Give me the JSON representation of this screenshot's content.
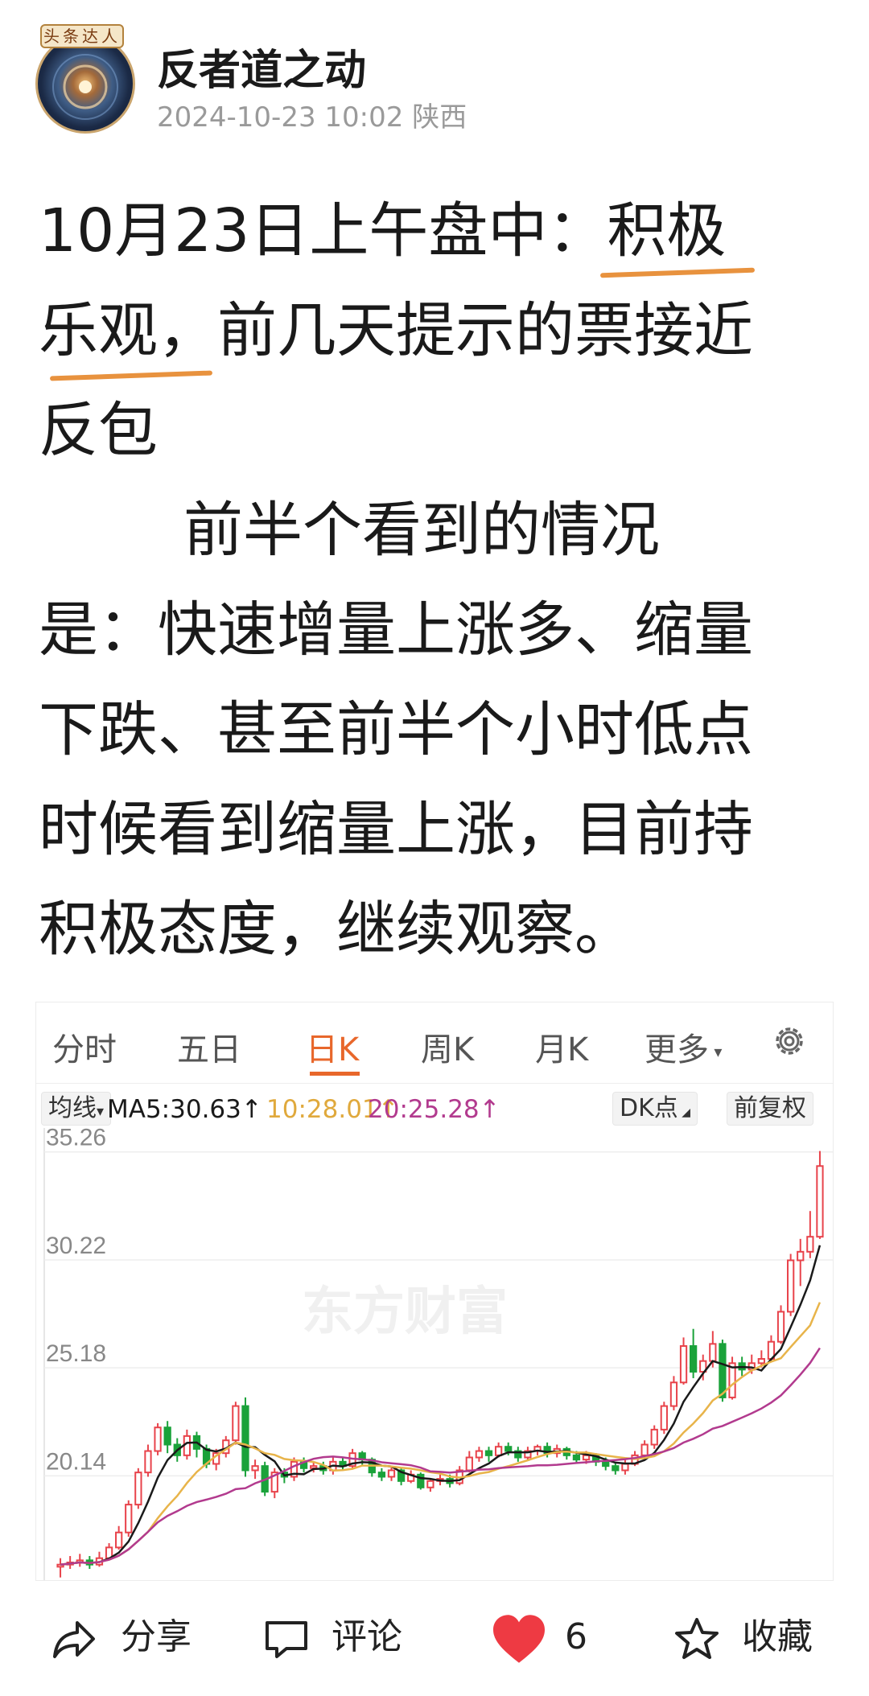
{
  "author": {
    "name": "反者道之动",
    "time": "2024-10-23 10:02",
    "location": "陕西",
    "badge": "头条达人"
  },
  "article": {
    "line1_pre": "10月23日上午盘中：",
    "highlight1": "积极",
    "highlight2": "乐观，",
    "line2_rest": "前几天提示的票接近",
    "line3": "反包",
    "para2_indent": "前半个看到的情况",
    "para2_body_1": "是：快速增量上涨多、缩量",
    "para2_body_2": "下跌、甚至前半个小时低点",
    "para2_body_3": "时候看到缩量上涨，目前持",
    "para2_body_4": "积极态度，继续观察。"
  },
  "stock": {
    "tabs": [
      "分时",
      "五日",
      "日K",
      "周K",
      "月K",
      "更多"
    ],
    "active_tab": "日K",
    "ma_selector": "均线",
    "ma5": "MA5:30.63",
    "ma10": "10:28.01",
    "ma20": "20:25.28",
    "dk_label": "DK点",
    "fuquan_label": "前复权",
    "watermark": "东方财富",
    "colors": {
      "up": "#e8434b",
      "down": "#1aa23a",
      "ma5": "#1a1a1a",
      "ma10": "#e8b44a",
      "ma20": "#b23a8e"
    },
    "controls": [
      "«",
      "−",
      "+",
      "‹",
      "›",
      "⤢"
    ]
  },
  "chart_data": {
    "type": "candlestick",
    "y_ticks": [
      "35.26",
      "30.22",
      "25.18",
      "20.14"
    ],
    "ylim": [
      15.5,
      36.0
    ],
    "candles": [
      [
        15.9,
        16.0,
        15.4,
        16.3
      ],
      [
        16.0,
        16.1,
        15.8,
        16.4
      ],
      [
        16.1,
        16.2,
        15.9,
        16.5
      ],
      [
        16.2,
        16.0,
        15.8,
        16.4
      ],
      [
        16.0,
        16.3,
        15.9,
        16.6
      ],
      [
        16.3,
        16.8,
        16.2,
        17.0
      ],
      [
        16.8,
        17.5,
        16.7,
        17.8
      ],
      [
        17.5,
        18.8,
        17.3,
        19.0
      ],
      [
        18.8,
        20.3,
        18.6,
        20.5
      ],
      [
        20.3,
        21.3,
        20.1,
        21.6
      ],
      [
        21.3,
        22.4,
        21.1,
        22.6
      ],
      [
        22.4,
        21.6,
        21.2,
        22.7
      ],
      [
        21.6,
        21.1,
        20.8,
        21.9
      ],
      [
        21.1,
        22.0,
        20.9,
        22.3
      ],
      [
        22.0,
        21.4,
        21.0,
        22.2
      ],
      [
        21.4,
        20.7,
        20.5,
        21.6
      ],
      [
        20.7,
        21.2,
        20.4,
        21.4
      ],
      [
        21.2,
        21.8,
        21.0,
        22.0
      ],
      [
        21.8,
        23.4,
        21.6,
        23.6
      ],
      [
        23.4,
        20.4,
        20.1,
        23.8
      ],
      [
        20.4,
        20.6,
        20.0,
        20.9
      ],
      [
        20.6,
        19.4,
        19.2,
        20.8
      ],
      [
        19.4,
        20.3,
        19.1,
        20.5
      ],
      [
        20.3,
        20.1,
        19.8,
        20.5
      ],
      [
        20.1,
        20.8,
        19.9,
        21.0
      ],
      [
        20.8,
        20.5,
        20.3,
        21.0
      ],
      [
        20.5,
        20.6,
        20.3,
        20.8
      ],
      [
        20.6,
        20.4,
        20.2,
        20.8
      ],
      [
        20.4,
        20.8,
        20.2,
        21.0
      ],
      [
        20.8,
        20.6,
        20.4,
        21.0
      ],
      [
        20.6,
        21.2,
        20.5,
        21.4
      ],
      [
        21.2,
        20.9,
        20.6,
        21.3
      ],
      [
        20.9,
        20.3,
        20.1,
        21.0
      ],
      [
        20.3,
        20.1,
        19.9,
        20.5
      ],
      [
        20.1,
        20.4,
        19.9,
        20.6
      ],
      [
        20.4,
        19.9,
        19.7,
        20.5
      ],
      [
        19.9,
        20.2,
        19.8,
        20.4
      ],
      [
        20.2,
        19.6,
        19.5,
        20.3
      ],
      [
        19.6,
        19.9,
        19.4,
        20.0
      ],
      [
        19.9,
        20.0,
        19.7,
        20.2
      ],
      [
        20.0,
        19.8,
        19.6,
        20.2
      ],
      [
        19.8,
        20.4,
        19.7,
        20.6
      ],
      [
        20.4,
        21.0,
        20.3,
        21.3
      ],
      [
        21.0,
        21.3,
        20.8,
        21.5
      ],
      [
        21.3,
        21.1,
        20.8,
        21.5
      ],
      [
        21.1,
        21.5,
        21.0,
        21.7
      ],
      [
        21.5,
        21.3,
        21.1,
        21.7
      ],
      [
        21.3,
        21.0,
        20.8,
        21.5
      ],
      [
        21.0,
        21.3,
        20.9,
        21.5
      ],
      [
        21.3,
        21.5,
        21.1,
        21.6
      ],
      [
        21.5,
        21.2,
        21.0,
        21.7
      ],
      [
        21.2,
        21.4,
        21.0,
        21.6
      ],
      [
        21.4,
        21.1,
        20.9,
        21.5
      ],
      [
        21.1,
        20.9,
        20.7,
        21.3
      ],
      [
        20.9,
        21.1,
        20.7,
        21.3
      ],
      [
        21.1,
        20.8,
        20.6,
        21.2
      ],
      [
        20.8,
        20.6,
        20.4,
        21.0
      ],
      [
        20.6,
        20.4,
        20.2,
        20.8
      ],
      [
        20.4,
        20.7,
        20.2,
        20.9
      ],
      [
        20.7,
        21.1,
        20.6,
        21.3
      ],
      [
        21.1,
        21.6,
        21.0,
        21.8
      ],
      [
        21.6,
        22.3,
        21.4,
        22.5
      ],
      [
        22.3,
        23.4,
        22.1,
        23.6
      ],
      [
        23.4,
        24.5,
        23.2,
        24.8
      ],
      [
        24.5,
        26.2,
        24.4,
        26.6
      ],
      [
        26.2,
        25.0,
        24.7,
        27.0
      ],
      [
        25.0,
        25.5,
        24.6,
        25.8
      ],
      [
        25.5,
        26.3,
        25.2,
        26.9
      ],
      [
        26.3,
        23.8,
        23.6,
        26.5
      ],
      [
        23.8,
        25.4,
        23.7,
        25.7
      ],
      [
        25.4,
        25.1,
        24.8,
        25.7
      ],
      [
        25.1,
        25.4,
        24.9,
        25.8
      ],
      [
        25.4,
        25.6,
        25.2,
        26.0
      ],
      [
        25.6,
        26.4,
        25.5,
        26.7
      ],
      [
        26.4,
        27.8,
        26.3,
        28.1
      ],
      [
        27.8,
        30.2,
        27.6,
        30.5
      ],
      [
        30.2,
        30.6,
        29.0,
        31.2
      ],
      [
        30.6,
        31.3,
        30.3,
        32.5
      ],
      [
        31.3,
        34.6,
        31.2,
        35.3
      ]
    ]
  },
  "bottombar": {
    "share": "分享",
    "comment": "评论",
    "likes": "6",
    "collect": "收藏"
  }
}
